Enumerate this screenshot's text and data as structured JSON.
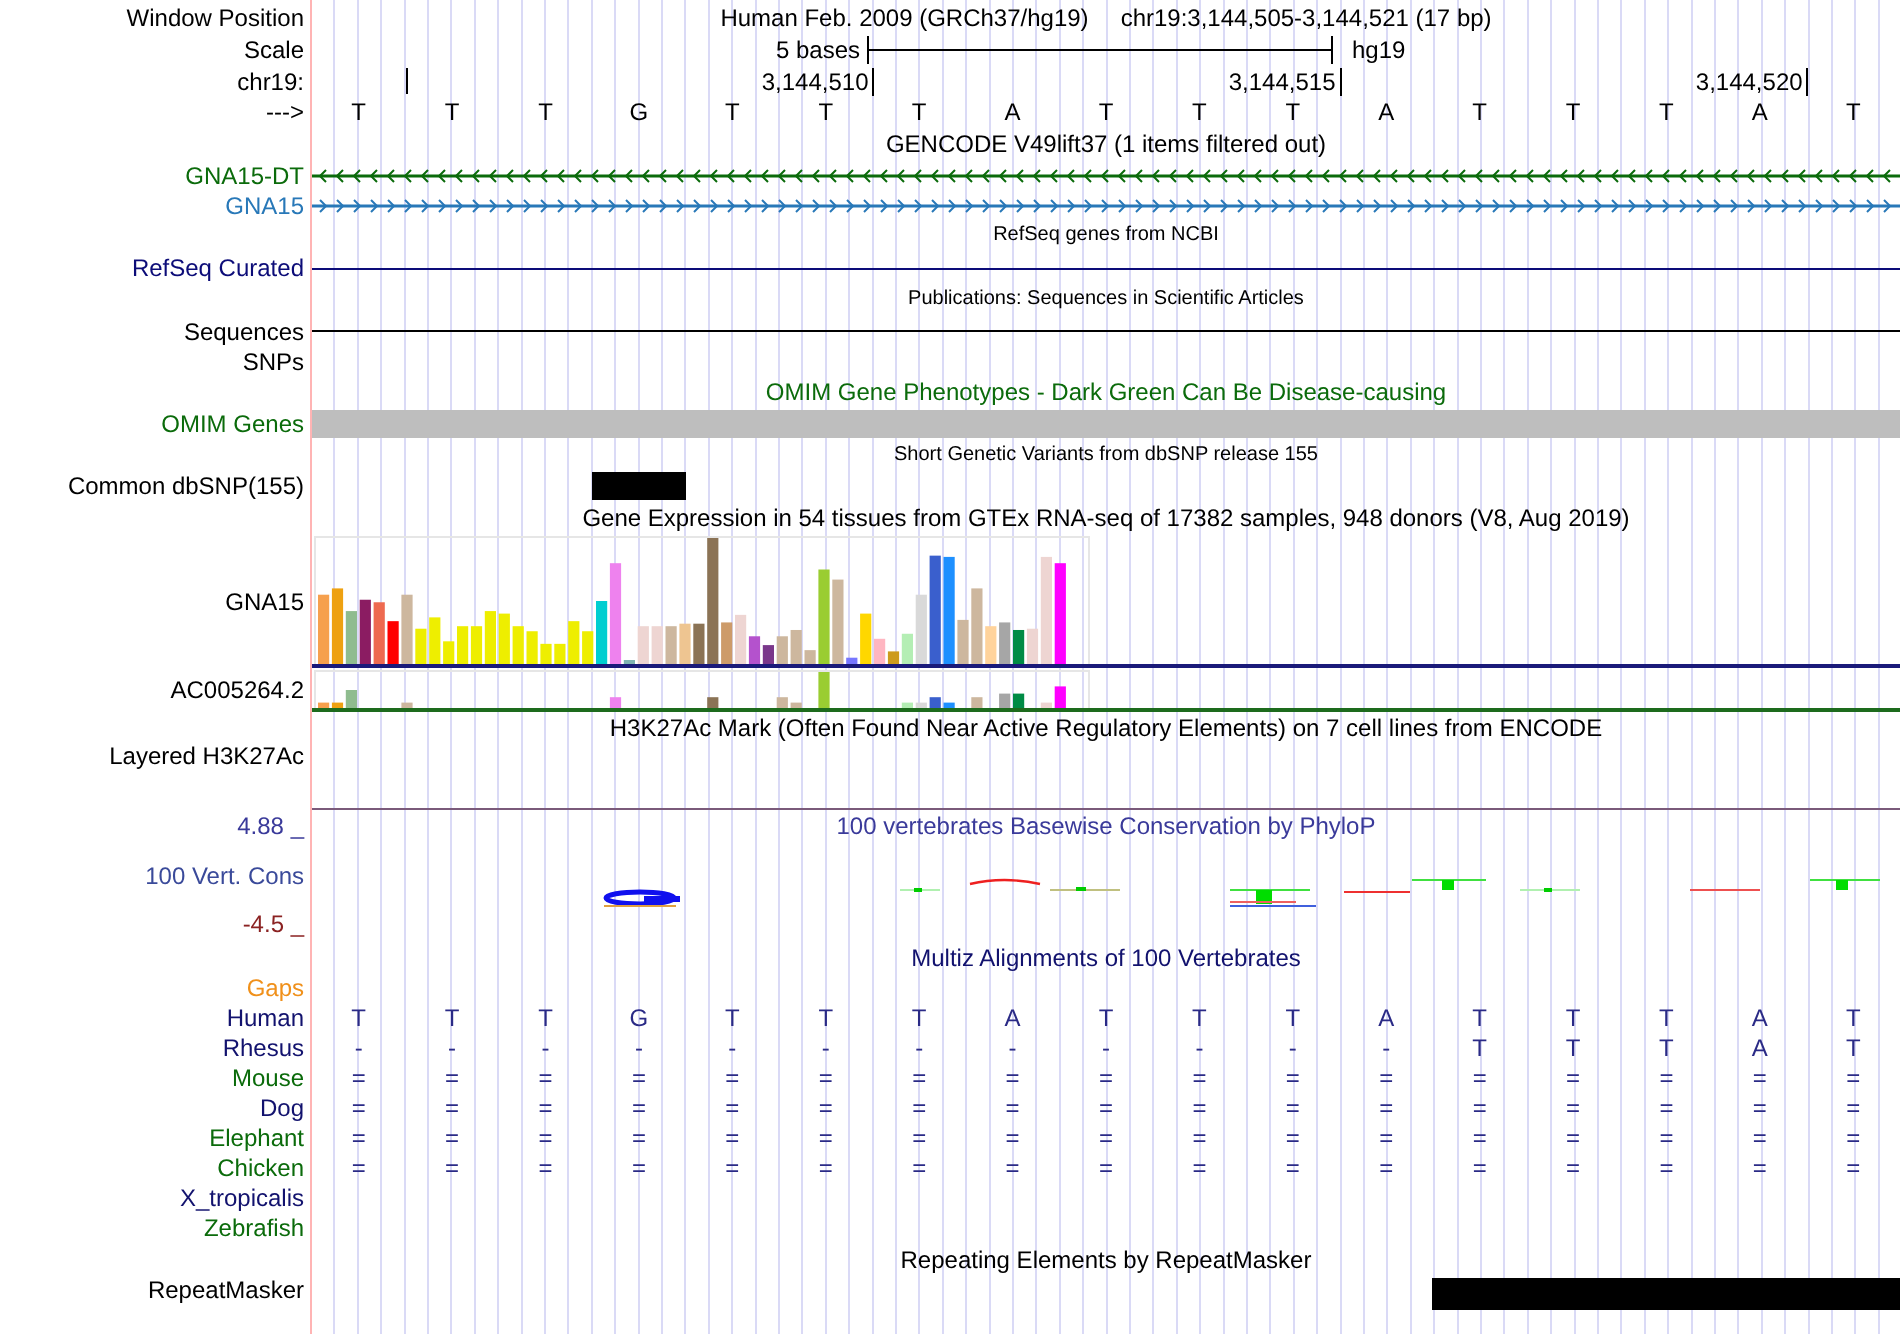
{
  "header": {
    "label": "Window Position",
    "assembly": "Human Feb. 2009 (GRCh37/hg19)",
    "position": "chr19:3,144,505-3,144,521 (17 bp)"
  },
  "scale": {
    "label": "Scale",
    "length": "5 bases",
    "assembly": "hg19"
  },
  "ruler": {
    "label": "chr19:",
    "ticks": [
      "3,144,510",
      "3,144,515",
      "3,144,520"
    ]
  },
  "sequence": {
    "label": "--->",
    "bases": [
      "T",
      "T",
      "T",
      "G",
      "T",
      "T",
      "T",
      "A",
      "T",
      "T",
      "T",
      "A",
      "T",
      "T",
      "T",
      "A",
      "T"
    ]
  },
  "gencode": {
    "title": "GENCODE V49lift37 (1 items filtered out)",
    "genes": [
      {
        "name": "GNA15-DT",
        "color": "#0b6b0b",
        "reverse": true
      },
      {
        "name": "GNA15",
        "color": "#2878b8",
        "reverse": false
      }
    ]
  },
  "refseq": {
    "title": "RefSeq genes from NCBI",
    "label": "RefSeq Curated"
  },
  "publications": {
    "title": "Publications: Sequences in Scientific Articles",
    "label": "Sequences"
  },
  "snps": {
    "label": "SNPs"
  },
  "omim": {
    "title": "OMIM Gene Phenotypes - Dark Green Can Be Disease-causing",
    "label": "OMIM Genes"
  },
  "dbsnp": {
    "title": "Short Genetic Variants from dbSNP release 155",
    "label": "Common dbSNP(155)"
  },
  "gtex": {
    "title": "Gene Expression in 54 tissues from GTEx RNA-seq of 17382 samples, 948 donors (V8, Aug 2019)",
    "genes": [
      {
        "name": "GNA15",
        "kind": "main"
      },
      {
        "name": "AC005264.2",
        "kind": "minor"
      }
    ]
  },
  "h3k27ac": {
    "title": "H3K27Ac Mark (Often Found Near Active Regulatory Elements) on 7 cell lines from ENCODE",
    "label": "Layered H3K27Ac"
  },
  "conservation": {
    "title": "100 vertebrates Basewise Conservation by PhyloP",
    "label": "100 Vert. Cons",
    "max": "4.88 _",
    "min": "-4.5 _"
  },
  "multiz": {
    "title": "Multiz Alignments of 100 Vertebrates",
    "gaps_label": "Gaps",
    "species": [
      {
        "name": "Human",
        "color": "#12126e",
        "bases": [
          "T",
          "T",
          "T",
          "G",
          "T",
          "T",
          "T",
          "A",
          "T",
          "T",
          "T",
          "A",
          "T",
          "T",
          "T",
          "A",
          "T"
        ]
      },
      {
        "name": "Rhesus",
        "color": "#12126e",
        "bases": [
          "-",
          "-",
          "-",
          "-",
          "-",
          "-",
          "-",
          "-",
          "-",
          "-",
          "-",
          "-",
          "T",
          "T",
          "T",
          "A",
          "T"
        ]
      },
      {
        "name": "Mouse",
        "color": "#0b6b0b",
        "bases": [
          "=",
          "=",
          "=",
          "=",
          "=",
          "=",
          "=",
          "=",
          "=",
          "=",
          "=",
          "=",
          "=",
          "=",
          "=",
          "=",
          "="
        ]
      },
      {
        "name": "Dog",
        "color": "#12126e",
        "bases": [
          "=",
          "=",
          "=",
          "=",
          "=",
          "=",
          "=",
          "=",
          "=",
          "=",
          "=",
          "=",
          "=",
          "=",
          "=",
          "=",
          "="
        ]
      },
      {
        "name": "Elephant",
        "color": "#0b6b0b",
        "bases": [
          "=",
          "=",
          "=",
          "=",
          "=",
          "=",
          "=",
          "=",
          "=",
          "=",
          "=",
          "=",
          "=",
          "=",
          "=",
          "=",
          "="
        ]
      },
      {
        "name": "Chicken",
        "color": "#0b6b0b",
        "bases": [
          "=",
          "=",
          "=",
          "=",
          "=",
          "=",
          "=",
          "=",
          "=",
          "=",
          "=",
          "=",
          "=",
          "=",
          "=",
          "=",
          "="
        ]
      },
      {
        "name": "X_tropicalis",
        "color": "#12126e"
      },
      {
        "name": "Zebrafish",
        "color": "#0b6b0b"
      }
    ]
  },
  "repeatmasker": {
    "title": "Repeating Elements by RepeatMasker",
    "label": "RepeatMasker"
  }
}
